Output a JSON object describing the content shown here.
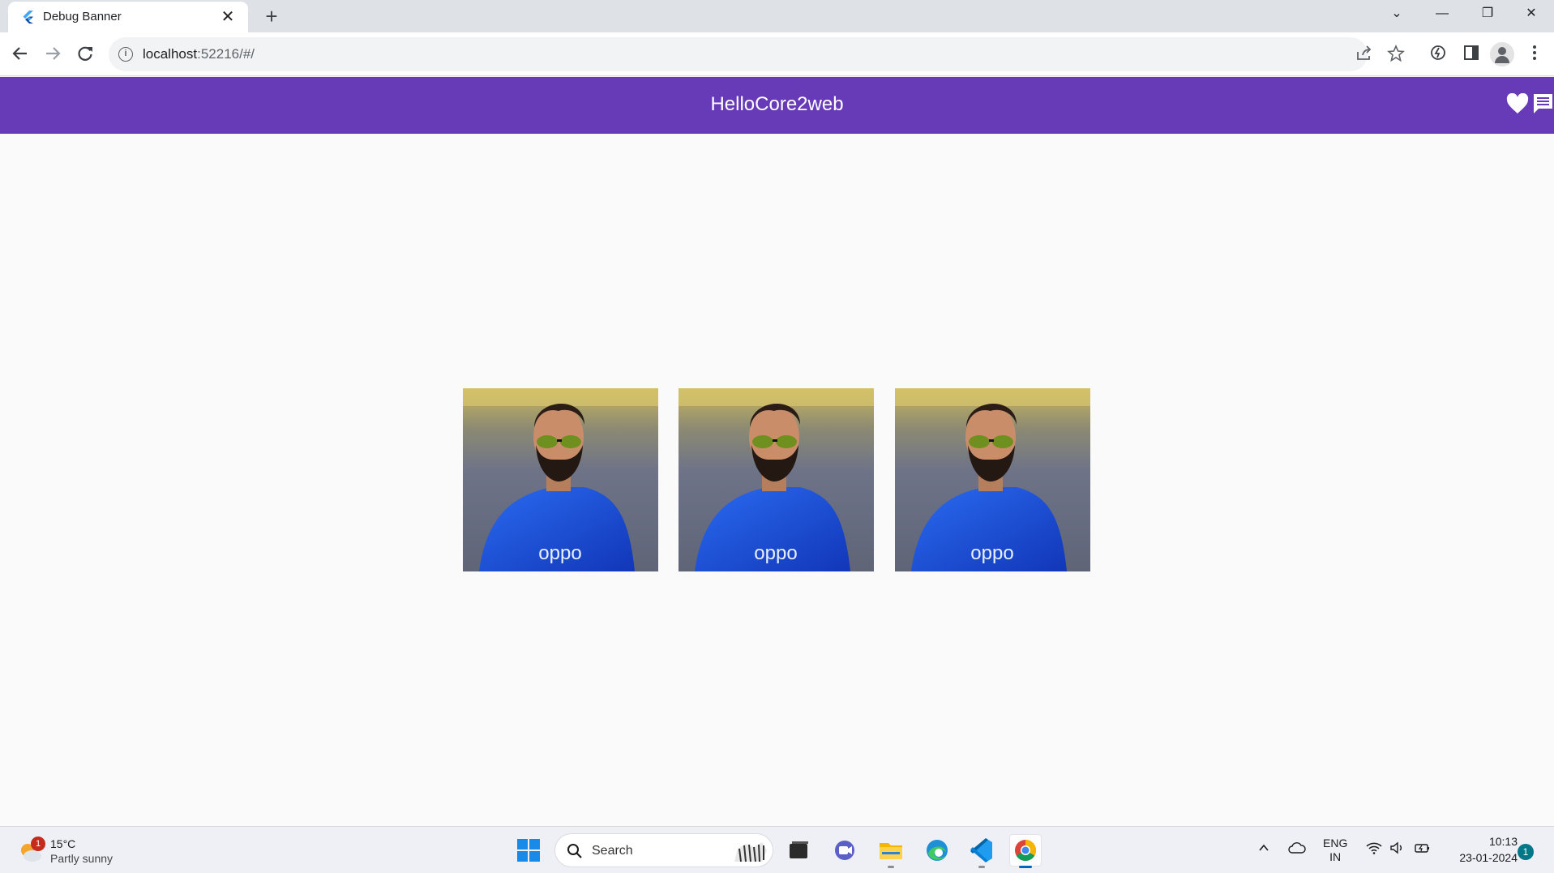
{
  "browser": {
    "tab_title": "Debug Banner",
    "tab_close": "✕",
    "new_tab": "+",
    "url_host": "localhost",
    "url_rest": ":52216/#/",
    "window_controls": [
      "⌄",
      "—",
      "❐",
      "✕"
    ]
  },
  "app": {
    "title": "HelloCore2web",
    "bar_color": "#673ab7",
    "actions": [
      "heart-icon",
      "comment-icon"
    ]
  },
  "gallery": {
    "images": [
      {
        "subject": "man with sunglasses in blue jersey",
        "jersey_text": "oppo"
      },
      {
        "subject": "man with sunglasses in blue jersey",
        "jersey_text": "oppo"
      },
      {
        "subject": "man with sunglasses in blue jersey",
        "jersey_text": "oppo"
      }
    ]
  },
  "taskbar": {
    "weather_temp": "15°C",
    "weather_condition": "Partly sunny",
    "weather_badge": "1",
    "search_label": "Search",
    "language_top": "ENG",
    "language_bottom": "IN",
    "time": "10:13",
    "date": "23-01-2024",
    "notification_count": "1"
  }
}
